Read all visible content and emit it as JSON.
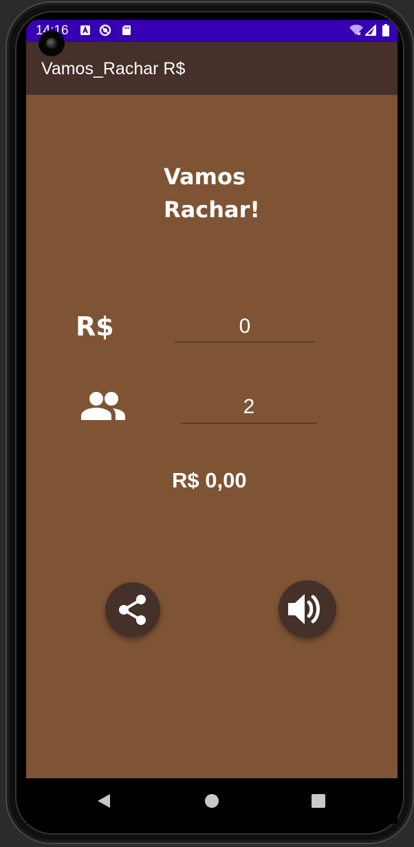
{
  "status_bar": {
    "time": "14:16",
    "icons": [
      "a-notification-icon",
      "no-disturb-icon",
      "sd-card-icon",
      "wifi-icon",
      "signal-icon",
      "battery-icon"
    ],
    "background": "#3700b3"
  },
  "app_bar": {
    "title": "Vamos_Rachar R$",
    "background": "#45302a"
  },
  "main": {
    "heading_line1": "Vamos",
    "heading_line2": "Rachar!",
    "amount_label": "R$",
    "amount_value": "0",
    "people_icon": "people-icon",
    "people_value": "2",
    "result": "R$ 0,00",
    "background": "#7e5435"
  },
  "actions": {
    "share_icon": "share-icon",
    "sound_icon": "volume-icon"
  },
  "nav_bar": {
    "icons": [
      "back-icon",
      "home-icon",
      "recents-icon"
    ]
  }
}
